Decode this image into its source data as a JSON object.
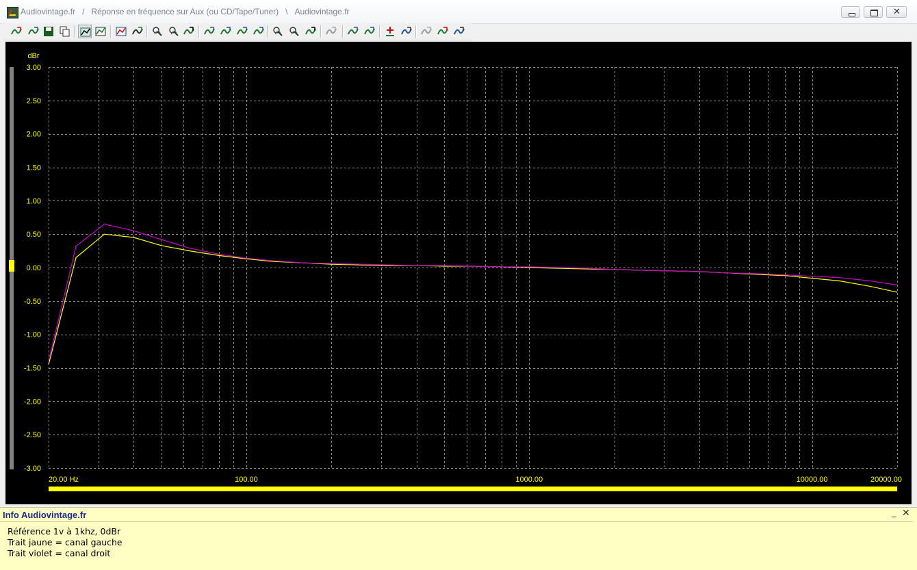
{
  "window": {
    "title_parts": [
      "Audiovintage.fr",
      "/",
      "Réponse en fréquence sur Aux (ou CD/Tape/Tuner)",
      "\\",
      "Audiovintage.fr"
    ],
    "close_glyph": "✕"
  },
  "toolbar": {
    "buttons": [
      "curve-add-icon",
      "curve-smooth-icon",
      "save-icon",
      "copy-icon",
      "grid-icon",
      "legend-icon",
      "chart-props-icon",
      "data-points-icon",
      "zoom-region-icon",
      "zoom-out-icon",
      "sine-view-icon",
      "curve-prev-icon",
      "curve-next-icon",
      "curve-up-icon",
      "curve-down-icon",
      "zoom-in-x-icon",
      "zoom-out-x-icon",
      "fit-icon",
      "calibrate-icon",
      "peak-up-icon",
      "peak-down-icon",
      "marker-add-icon",
      "marker-move-icon",
      "undo-icon",
      "compare-icon",
      "reference-icon"
    ]
  },
  "chart_data": {
    "type": "line",
    "ylabel": "dBr",
    "ylim": [
      -3.0,
      3.0
    ],
    "yticks": [
      "3.00",
      "2.50",
      "2.00",
      "1.50",
      "1.00",
      "0.50",
      "0.00",
      "-0.50",
      "-1.00",
      "-1.50",
      "-2.00",
      "-2.50",
      "-3.00"
    ],
    "xscale": "log",
    "xlim": [
      20,
      20000
    ],
    "xticks": [
      {
        "value": 20,
        "label": "20.00 Hz"
      },
      {
        "value": 100,
        "label": "100.00"
      },
      {
        "value": 1000,
        "label": "1000.00"
      },
      {
        "value": 10000,
        "label": "10000.00"
      },
      {
        "value": 20000,
        "label": "20000.00"
      }
    ],
    "grid": true,
    "series": [
      {
        "color": "#ffff00",
        "x": [
          20,
          25,
          31.5,
          40,
          50,
          63,
          80,
          100,
          125,
          160,
          200,
          250,
          315,
          400,
          500,
          630,
          800,
          1000,
          1250,
          1600,
          2000,
          2500,
          3150,
          4000,
          5000,
          6300,
          8000,
          10000,
          12500,
          16000,
          20000
        ],
        "y": [
          -1.45,
          0.15,
          0.5,
          0.45,
          0.33,
          0.25,
          0.18,
          0.13,
          0.09,
          0.07,
          0.05,
          0.04,
          0.03,
          0.03,
          0.02,
          0.02,
          0.01,
          0.0,
          -0.01,
          -0.02,
          -0.03,
          -0.04,
          -0.05,
          -0.06,
          -0.08,
          -0.1,
          -0.12,
          -0.16,
          -0.2,
          -0.28,
          -0.37
        ]
      },
      {
        "color": "#cc00cc",
        "x": [
          20,
          25,
          31.5,
          40,
          50,
          63,
          80,
          100,
          125,
          160,
          200,
          250,
          315,
          400,
          500,
          630,
          800,
          1000,
          1250,
          1600,
          2000,
          2500,
          3150,
          4000,
          5000,
          6300,
          8000,
          10000,
          12500,
          16000,
          20000
        ],
        "y": [
          -1.4,
          0.32,
          0.65,
          0.55,
          0.42,
          0.29,
          0.2,
          0.14,
          0.1,
          0.07,
          0.06,
          0.05,
          0.04,
          0.03,
          0.03,
          0.02,
          0.01,
          0.01,
          0.0,
          -0.01,
          -0.03,
          -0.04,
          -0.05,
          -0.06,
          -0.08,
          -0.09,
          -0.11,
          -0.13,
          -0.15,
          -0.2,
          -0.26
        ]
      }
    ]
  },
  "info": {
    "title": "Info Audiovintage.fr",
    "min_glyph": "_",
    "close_glyph": "✕",
    "lines": [
      "Référence 1v à 1khz, 0dBr",
      "Trait jaune = canal gauche",
      "Trait violet = canal droit"
    ]
  }
}
